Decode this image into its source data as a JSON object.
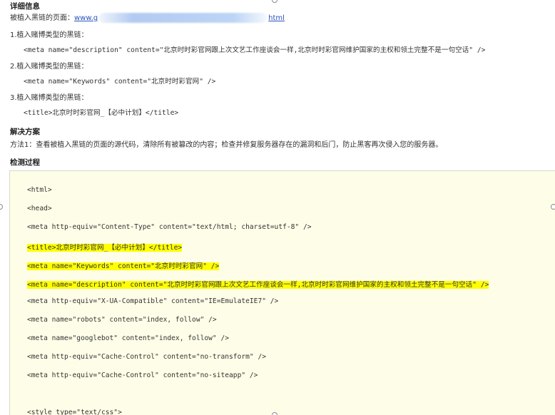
{
  "details": {
    "heading": "详细信息",
    "implanted_label": "被植入黑链的页面：",
    "url_start": "www.g",
    "url_end": "html",
    "type1_title": "1.植入赌博类型的黑链：",
    "type1_code": "<meta name=\"description\" content=\"北京时时彩官网跟上次文艺工作座谈会一样,北京时时彩官网维护国家的主权和领土完整不是一句空话\" />",
    "type2_title": "2.植入赌博类型的黑链：",
    "type2_code": "<meta name=\"Keywords\" content=\"北京时时彩官网\" />",
    "type3_title": "3.植入赌博类型的黑链：",
    "type3_code": "<title>北京时时彩官网_【必中计划】</title>"
  },
  "solution": {
    "heading": "解决方案",
    "text": "方法1：查看被植入黑链的页面的源代码，清除所有被篡改的内容；检查并修复服务器存在的漏洞和后门，防止黑客再次侵入您的服务器。"
  },
  "detection": {
    "heading": "检测过程",
    "code_lines": [
      "<html>",
      "<head>",
      "<meta http-equiv=\"Content-Type\" content=\"text/html; charset=utf-8\" />",
      "<title>北京时时彩官网_【必中计划】</title>",
      "<meta name=\"Keywords\" content=\"北京时时彩官网\" />",
      "<meta name=\"description\" content=\"北京时时彩官网跟上次文艺工作座谈会一样,北京时时彩官网维护国家的主权和领土完整不是一句空话\" />",
      "<meta http-equiv=\"X-UA-Compatible\" content=\"IE=EmulateIE7\" />",
      "<meta name=\"robots\" content=\"index, follow\" />",
      "<meta name=\"googlebot\" content=\"index, follow\" />",
      "<meta http-equiv=\"Cache-Control\" content=\"no-transform\" />",
      "<meta http-equiv=\"Cache-Control\" content=\"no-siteapp\" />",
      "<style type=\"text/css\">"
    ],
    "highlighted_lines": [
      3,
      4,
      5
    ],
    "highlight_color": "#ffff00"
  }
}
